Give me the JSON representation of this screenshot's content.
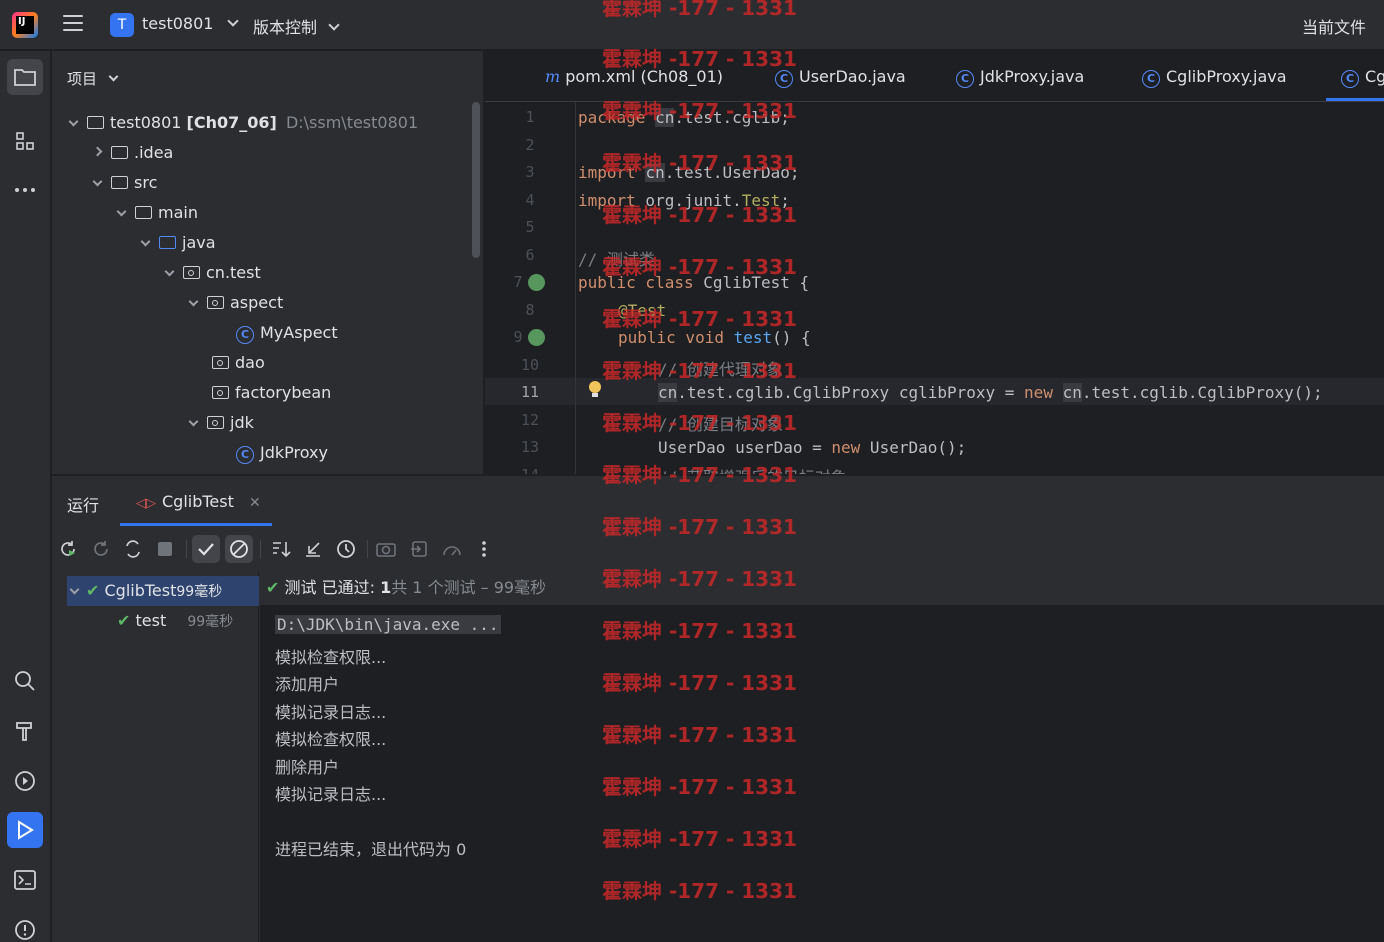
{
  "titlebar": {
    "project_badge": "T",
    "project_name": "test0801",
    "vcs_label": "版本控制",
    "current_file_label": "当前文件"
  },
  "project_panel": {
    "title": "项目",
    "root": {
      "name": "test0801",
      "module": "[Ch07_06]",
      "path": "D:\\ssm\\test0801"
    },
    "items": [
      {
        "label": ".idea"
      },
      {
        "label": "src"
      },
      {
        "label": "main"
      },
      {
        "label": "java"
      },
      {
        "label": "cn.test"
      },
      {
        "label": "aspect"
      },
      {
        "label": "MyAspect"
      },
      {
        "label": "dao"
      },
      {
        "label": "factorybean"
      },
      {
        "label": "jdk"
      },
      {
        "label": "JdkProxy"
      }
    ]
  },
  "editor_tabs": [
    {
      "label": "pom.xml (Ch08_01)",
      "prefix": "m"
    },
    {
      "label": "UserDao.java"
    },
    {
      "label": "JdkProxy.java"
    },
    {
      "label": "CglibProxy.java"
    },
    {
      "label": "Cg"
    }
  ],
  "editor": {
    "line_numbers": [
      "1",
      "2",
      "3",
      "4",
      "5",
      "6",
      "7",
      "8",
      "9",
      "10",
      "11",
      "12",
      "13",
      "14"
    ],
    "current_line": "11",
    "lines": {
      "l1_kw": "package",
      "l1_pkg_a": "cn",
      "l1_pkg_b": ".test.cglib;",
      "l3_kw": "import",
      "l3_a": "cn",
      "l3_b": ".test.UserDao;",
      "l4_kw": "import",
      "l4_a": " org.junit.",
      "l4_b": "Test",
      "l4_c": ";",
      "l6": "// 测试类",
      "l7_kw": "public class",
      "l7_rest": " CglibTest {",
      "l8": "@Test",
      "l9_kw": "public void",
      "l9_fn": "test",
      "l9_rest": "() {",
      "l10": "// 创建代理对象",
      "l11_a": "cn",
      "l11_b": ".test.cglib.CglibProxy cglibProxy = ",
      "l11_kw": "new",
      "l11_c": "cn",
      "l11_d": ".test.cglib.CglibProxy();",
      "l12": "// 创建目标对象",
      "l13_a": "UserDao userDao = ",
      "l13_kw": "new",
      "l13_b": " UserDao();",
      "l14": "// 获取增强后的目标对象"
    }
  },
  "run_panel": {
    "title": "运行",
    "tab_label": "CglibTest",
    "tree": [
      {
        "label": "CglibTest",
        "time": "99毫秒"
      },
      {
        "label": "test",
        "time": "99毫秒"
      }
    ],
    "status_prefix": "测试 已通过: ",
    "status_count": "1",
    "status_suffix": "共 1 个测试 – 99毫秒",
    "console_lines": [
      "D:\\JDK\\bin\\java.exe ...",
      "模拟检查权限...",
      "添加用户",
      "模拟记录日志...",
      "模拟检查权限...",
      "删除用户",
      "模拟记录日志...",
      "",
      "进程已结束，退出代码为 0"
    ]
  },
  "watermark": "霍霖坤 -177 - 1331",
  "colors": {
    "accent": "#3574f0",
    "success": "#5fb865",
    "watermark": "#c82828"
  }
}
